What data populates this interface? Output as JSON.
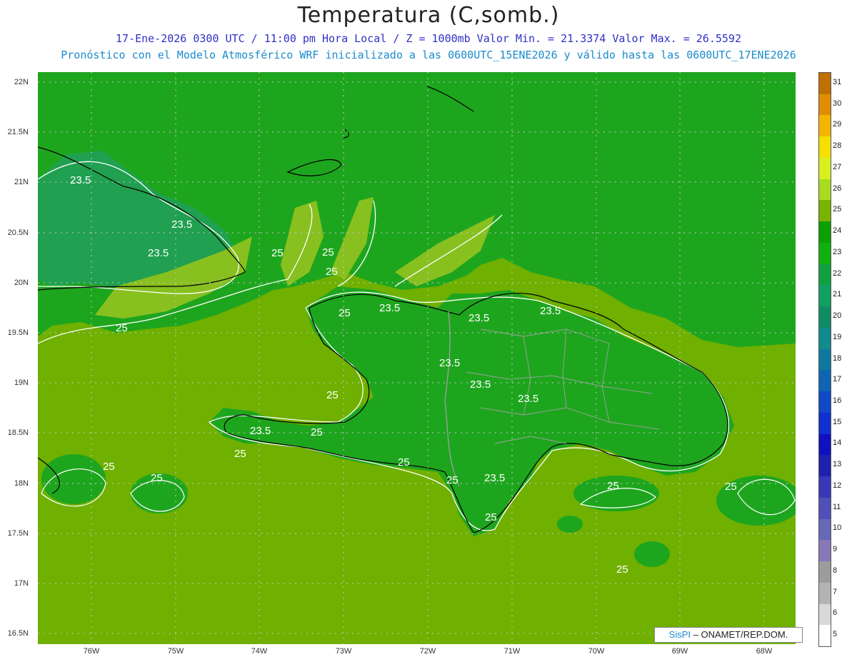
{
  "header": {
    "title": "Temperatura (C,somb.)",
    "line1": "17-Ene-2026 0300 UTC / 11:00 pm Hora Local / Z = 1000mb  Valor Min. = 21.3374  Valor Max. = 26.5592",
    "line2": "Pronóstico con el Modelo Atmosférico WRF inicializado a las 0600UTC_15ENE2026 y válido hasta las  0600UTC_17ENE2026"
  },
  "axes": {
    "lat_labels": [
      "22N",
      "21.5N",
      "21N",
      "20.5N",
      "20N",
      "19.5N",
      "19N",
      "18.5N",
      "18N",
      "17.5N",
      "17N",
      "16.5N"
    ],
    "lon_labels": [
      "76W",
      "75W",
      "74W",
      "73W",
      "72W",
      "71W",
      "70W",
      "69W",
      "68W"
    ]
  },
  "contour_labels": [
    "23.5",
    "23.5",
    "23.5",
    "25",
    "25",
    "25",
    "23.5",
    "23.5",
    "23.5",
    "25",
    "25",
    "23.5",
    "23.5",
    "23.5",
    "23.5",
    "25",
    "25",
    "25",
    "25",
    "25",
    "23.5",
    "25",
    "25",
    "25",
    "25",
    "25",
    "25"
  ],
  "colorbar": {
    "labels": [
      "31",
      "30",
      "29",
      "28",
      "27",
      "26",
      "25",
      "24",
      "23",
      "22",
      "21",
      "20",
      "19",
      "18",
      "17",
      "16",
      "15",
      "14",
      "13",
      "12",
      "11",
      "10",
      "9",
      "8",
      "7",
      "6",
      "5"
    ],
    "colors": [
      "#c07000",
      "#e08c00",
      "#f5b400",
      "#f5e000",
      "#d8f020",
      "#a8dc20",
      "#78b400",
      "#0ca000",
      "#10b010",
      "#10a040",
      "#10a060",
      "#108c64",
      "#108c8c",
      "#1078a0",
      "#1064b4",
      "#1048c8",
      "#1030d0",
      "#1010c0",
      "#2020b0",
      "#3838b8",
      "#5050b8",
      "#6868b8",
      "#8878b8",
      "#9c9c9c",
      "#b4b4b4",
      "#d8d8d8",
      "#ffffff"
    ]
  },
  "map_colors": {
    "sea_25": "#6fb000",
    "land_24": "#1ea51e",
    "cool_23": "#20a050",
    "warm_26": "#88c020",
    "contour": "#ffffff",
    "coast": "#000000",
    "border": "#a0a0a0"
  },
  "credit": {
    "brand": "SisPI",
    "text": " – ONAMET/REP.DOM."
  }
}
